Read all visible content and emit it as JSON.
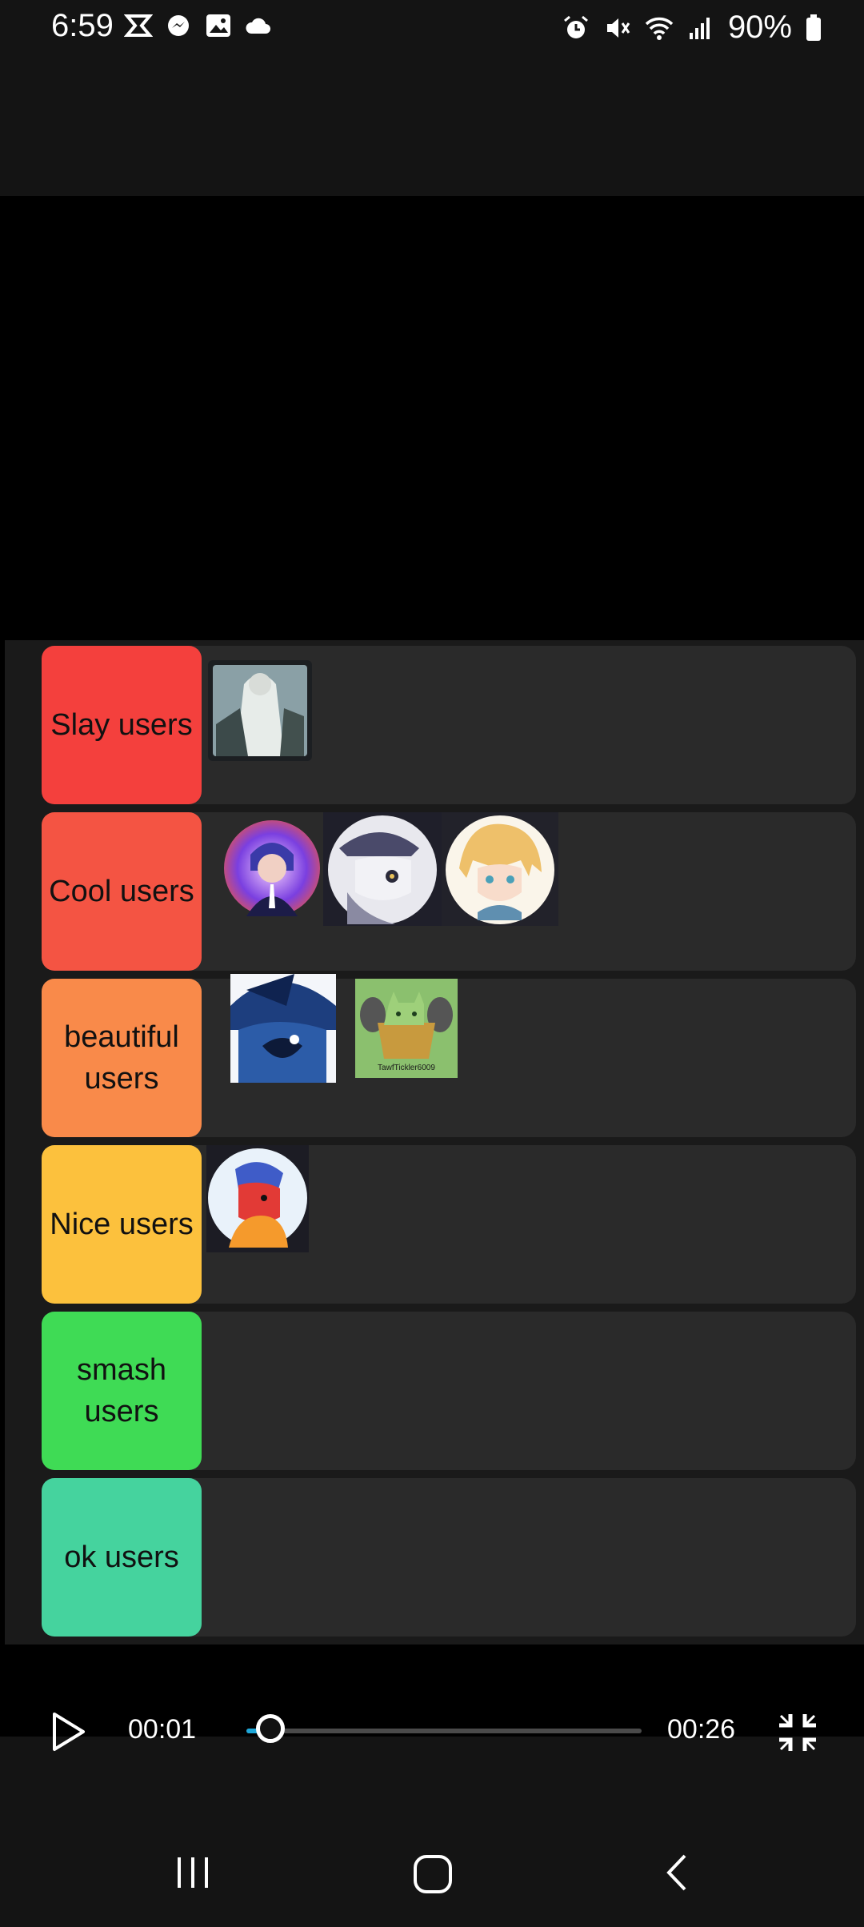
{
  "status_bar": {
    "time": "6:59",
    "battery": "90%",
    "left_icons": [
      "capcut-icon",
      "messenger-icon",
      "gallery-icon",
      "cloud-icon"
    ],
    "right_icons": [
      "alarm-icon",
      "mute-icon",
      "wifi-icon",
      "signal-icon",
      "battery-icon"
    ]
  },
  "tiers": [
    {
      "label": "Slay users",
      "color": "#f4403d",
      "items": [
        "avatar-anime-girl-white-dress"
      ]
    },
    {
      "label": "Cool users",
      "color": "#f45443",
      "items": [
        "avatar-purple-galaxy-character",
        "avatar-grey-hat-character",
        "avatar-blonde-elf-character"
      ]
    },
    {
      "label": "beautiful users",
      "color": "#f98a4a",
      "items": [
        "avatar-blue-hat-character",
        "avatar-green-cat-tawftickler"
      ]
    },
    {
      "label": "Nice users",
      "color": "#fcc13d",
      "items": [
        "avatar-red-character-orange-hoodie"
      ]
    },
    {
      "label": "smash users",
      "color": "#3fdb55",
      "items": []
    },
    {
      "label": "ok users",
      "color": "#45d39e",
      "items": []
    }
  ],
  "item_texts": {
    "tawf_caption": "TawfTickler6009"
  },
  "player": {
    "current_time": "00:01",
    "total_time": "00:26",
    "progress_fraction": 0.04
  },
  "colors": {
    "accent": "#1ea7d9",
    "row_bg": "#2a2a2a",
    "status_bg": "#141414"
  }
}
